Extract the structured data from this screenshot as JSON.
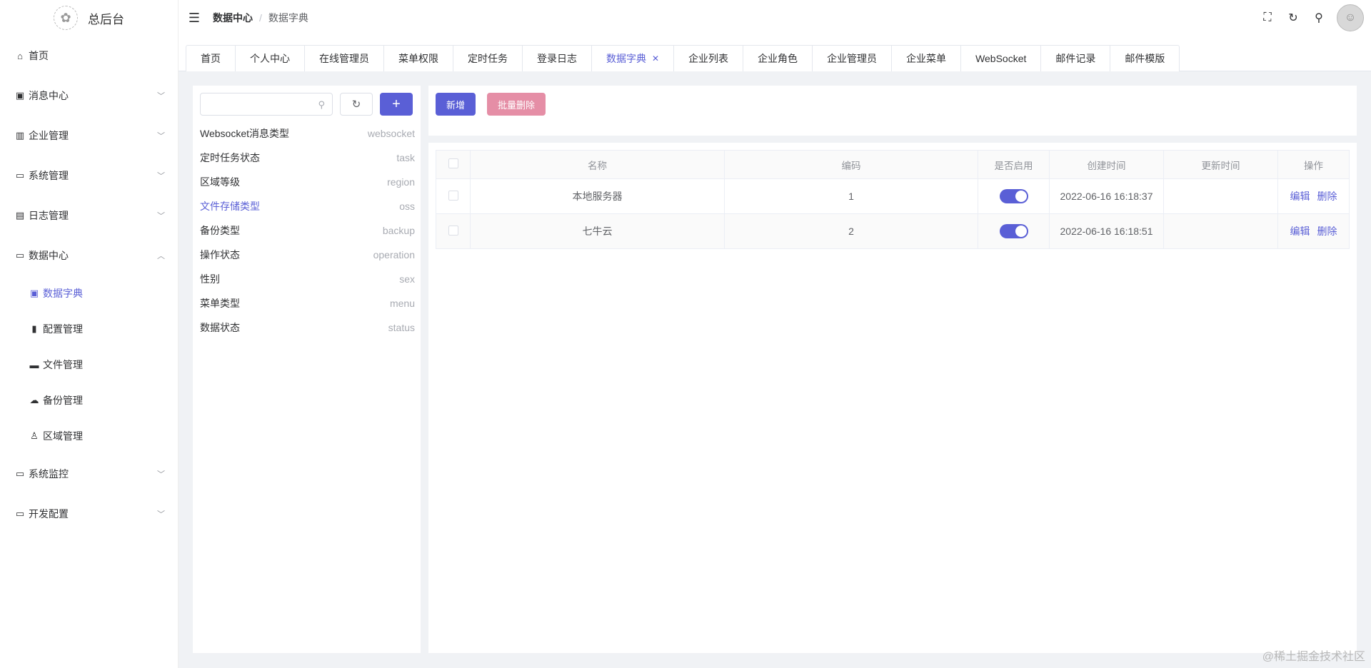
{
  "app": {
    "title": "总后台"
  },
  "header": {
    "breadcrumb": [
      "数据中心",
      "数据字典"
    ],
    "icons": [
      "fullscreen-icon",
      "refresh-icon",
      "broom-icon",
      "avatar"
    ]
  },
  "sidebar": {
    "items": [
      {
        "label": "首页",
        "icon": "home-icon",
        "chevron": false
      },
      {
        "label": "消息中心",
        "icon": "message-icon",
        "chevron": "down"
      },
      {
        "label": "企业管理",
        "icon": "chart-icon",
        "chevron": "down"
      },
      {
        "label": "系统管理",
        "icon": "monitor-icon",
        "chevron": "down"
      },
      {
        "label": "日志管理",
        "icon": "log-icon",
        "chevron": "down"
      },
      {
        "label": "数据中心",
        "icon": "data-icon",
        "chevron": "up"
      },
      {
        "label": "系统监控",
        "icon": "monitor-icon",
        "chevron": "down"
      },
      {
        "label": "开发配置",
        "icon": "dev-icon",
        "chevron": "down"
      }
    ],
    "subitems": [
      {
        "label": "数据字典",
        "icon": "dict-icon",
        "active": true
      },
      {
        "label": "配置管理",
        "icon": "book-icon",
        "active": false
      },
      {
        "label": "文件管理",
        "icon": "folder-icon",
        "active": false
      },
      {
        "label": "备份管理",
        "icon": "cloud-icon",
        "active": false
      },
      {
        "label": "区域管理",
        "icon": "user-pin-icon",
        "active": false
      }
    ]
  },
  "tabs": [
    {
      "label": "首页"
    },
    {
      "label": "个人中心"
    },
    {
      "label": "在线管理员"
    },
    {
      "label": "菜单权限"
    },
    {
      "label": "定时任务"
    },
    {
      "label": "登录日志"
    },
    {
      "label": "数据字典",
      "active": true,
      "closable": true
    },
    {
      "label": "企业列表"
    },
    {
      "label": "企业角色"
    },
    {
      "label": "企业管理员"
    },
    {
      "label": "企业菜单"
    },
    {
      "label": "WebSocket"
    },
    {
      "label": "邮件记录"
    },
    {
      "label": "邮件模版"
    }
  ],
  "dict": {
    "search_placeholder": "",
    "items": [
      {
        "name": "Websocket消息类型",
        "code": "websocket"
      },
      {
        "name": "定时任务状态",
        "code": "task"
      },
      {
        "name": "区域等级",
        "code": "region"
      },
      {
        "name": "文件存储类型",
        "code": "oss",
        "active": true
      },
      {
        "name": "备份类型",
        "code": "backup"
      },
      {
        "name": "操作状态",
        "code": "operation"
      },
      {
        "name": "性别",
        "code": "sex"
      },
      {
        "name": "菜单类型",
        "code": "menu"
      },
      {
        "name": "数据状态",
        "code": "status"
      }
    ]
  },
  "toolbar": {
    "add_label": "新增",
    "batch_delete_label": "批量删除"
  },
  "table": {
    "headers": [
      "名称",
      "编码",
      "是否启用",
      "创建时间",
      "更新时间",
      "操作"
    ],
    "rows": [
      {
        "name": "本地服务器",
        "code": "1",
        "enabled": true,
        "created": "2022-06-16 16:18:37",
        "updated": ""
      },
      {
        "name": "七牛云",
        "code": "2",
        "enabled": true,
        "created": "2022-06-16 16:18:51",
        "updated": ""
      }
    ],
    "actions": {
      "edit": "编辑",
      "delete": "删除"
    }
  },
  "colors": {
    "primary": "#5a5fd6",
    "danger_light": "#e58ea6"
  },
  "watermark": "@稀土掘金技术社区"
}
